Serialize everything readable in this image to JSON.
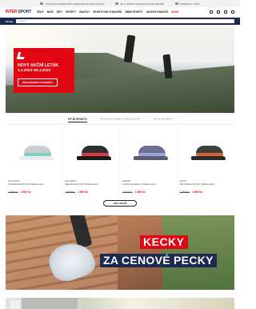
{
  "topbar": {
    "items": [
      "DOPRAVA ZDARMA PŘI OBJEDNÁVCE NAD 1599 KČ",
      "ZA 1 HODINU ZDARMA NA PRODEJNĚ",
      "PRODEJNY SVĚT"
    ]
  },
  "header": {
    "logo": {
      "part1": "INTER",
      "part2": "SPORT"
    },
    "nav": [
      "ŽENY",
      "MUŽI",
      "DĚTI",
      "SPORTY",
      "ZNAČKY",
      "SPORTOVNÍ VYBAVENÍ",
      "ZIMNÍ SPORTY",
      "ADVENT/VÁNOCE",
      "AKCE"
    ]
  },
  "search": {
    "label": "Hledat",
    "placeholder": "Hledat..."
  },
  "hero": {
    "title_line1": "NOVÝ AKČNÍ LETÁK",
    "title_line2": "1.3.2023–26.3.2023",
    "button": "PROHLÉDNOUT NABÍDKU"
  },
  "tabs": [
    "TIP ZE ŠPORTU",
    "TIP SPORTOVNÍCH SPECIALISTŮ",
    "TIP ZE SPORTU"
  ],
  "products": [
    {
      "brand": "SALOMON",
      "name": "XA Dubrovnik GTX W Outdoor obuv",
      "old_price": "3 499 Kč",
      "new_price": "1 999 Kč",
      "upper": "#c9cdd0",
      "sole": "#e9ecee",
      "accent": "#7ad1c3"
    },
    {
      "brand": "SALOMON",
      "name": "Speedcross 6 GTX Trailová obuv",
      "old_price": "3 899 Kč",
      "new_price": "1 999 Kč",
      "upper": "#2b2f33",
      "sole": "#1a1a1a",
      "accent": "#e03a3a"
    },
    {
      "brand": "ADIDAS",
      "name": "Terrex Free Hiker 2 Outdoor obuv",
      "old_price": "3 499 Kč",
      "new_price": "1 999 Kč",
      "upper": "#6b6f92",
      "sole": "#5a5c72",
      "accent": "#9aa0d8"
    },
    {
      "brand": "ASICS",
      "name": "Gel-Trabuco 10 GTX Trailová obuv",
      "old_price": "3 499 Kč",
      "new_price": "1 999 Kč",
      "upper": "#3b3f3a",
      "sole": "#2a2a2a",
      "accent": "#d9613a"
    }
  ],
  "more_button": "VÍCE ZBOŽÍ",
  "banner": {
    "line1": "KECKY",
    "line2": "ZA CENOVÉ PECKY"
  },
  "colors": {
    "brand_red": "#e20613",
    "brand_navy": "#1b2a4e"
  }
}
